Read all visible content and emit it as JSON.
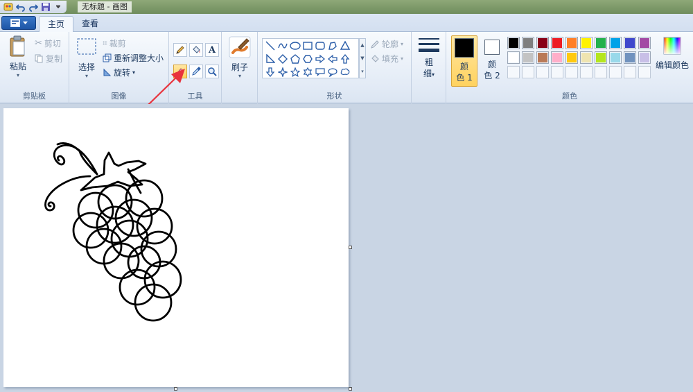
{
  "window": {
    "title": "无标题 - 画图"
  },
  "tabs": [
    {
      "label": "主页",
      "active": true
    },
    {
      "label": "查看",
      "active": false
    }
  ],
  "clipboard": {
    "paste_label": "粘贴",
    "cut_label": "剪切",
    "copy_label": "复制",
    "group_label": "剪贴板"
  },
  "image": {
    "select_label": "选择",
    "crop_label": "裁剪",
    "resize_label": "重新调整大小",
    "rotate_label": "旋转",
    "group_label": "图像"
  },
  "tools": {
    "group_label": "工具",
    "active_tool": "eraser"
  },
  "brushes": {
    "label": "刷子"
  },
  "shapes": {
    "outline_label": "轮廓",
    "fill_label": "填充",
    "group_label": "形状"
  },
  "size": {
    "label_line1": "粗",
    "label_line2": "细"
  },
  "colors": {
    "color1_line1": "颜",
    "color1_line2": "色 1",
    "color2_line1": "颜",
    "color2_line2": "色 2",
    "edit_label": "编辑颜色",
    "group_label": "颜色",
    "color1": "#000000",
    "color2": "#ffffff",
    "palette_row1": [
      "#000000",
      "#7f7f7f",
      "#880015",
      "#ed1c24",
      "#ff7f27",
      "#fff200",
      "#22b14c",
      "#00a2e8",
      "#3f48cc",
      "#a349a4"
    ],
    "palette_row2": [
      "#ffffff",
      "#c3c3c3",
      "#b97a57",
      "#ffaec9",
      "#ffc90e",
      "#efe4b0",
      "#b5e61d",
      "#99d9ea",
      "#7092be",
      "#c8bfe7"
    ]
  },
  "accent": {
    "arrow": "#e8333d",
    "ribbon_bg": "#e3ebf6",
    "workspace_bg": "#c9d5e4"
  }
}
